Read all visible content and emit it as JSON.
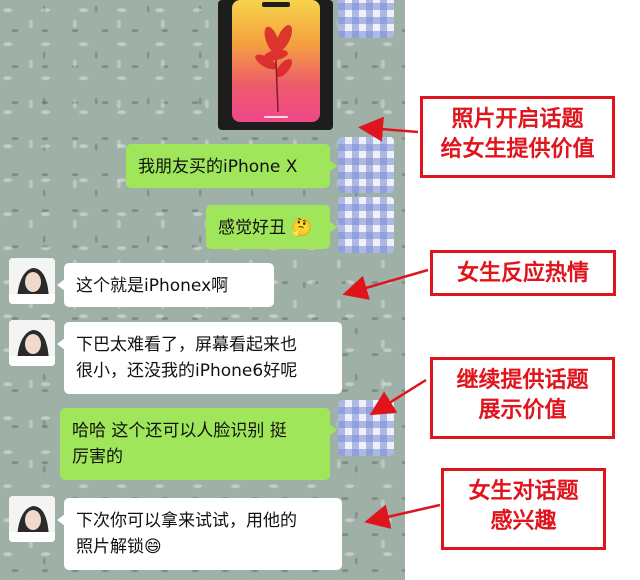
{
  "messages": [
    {
      "side": "right",
      "text": "我朋友买的iPhone X"
    },
    {
      "side": "right",
      "text": "感觉好丑",
      "emoji": "🤔"
    },
    {
      "side": "left",
      "text": "这个就是iPhonex啊"
    },
    {
      "side": "left",
      "line1": "下巴太难看了，屏幕看起来也",
      "line2": "很小，还没我的iPhone6好呢"
    },
    {
      "side": "right",
      "line1": "哈哈 这个还可以人脸识别 挺",
      "line2": "厉害的"
    },
    {
      "side": "left",
      "line1": "下次你可以拿来试试，用他的",
      "line2": "照片解锁",
      "emoji": "😄"
    }
  ],
  "annotations": [
    {
      "line1": "照片开启话题",
      "line2": "给女生提供价值"
    },
    {
      "line1": "女生反应热情"
    },
    {
      "line1": "继续提供话题",
      "line2": "展示价值"
    },
    {
      "line1": "女生对话题",
      "line2": "感兴趣"
    }
  ],
  "colors": {
    "annotation": "#e0141c",
    "bubble_green": "#9fe65a",
    "bubble_white": "#ffffff"
  }
}
